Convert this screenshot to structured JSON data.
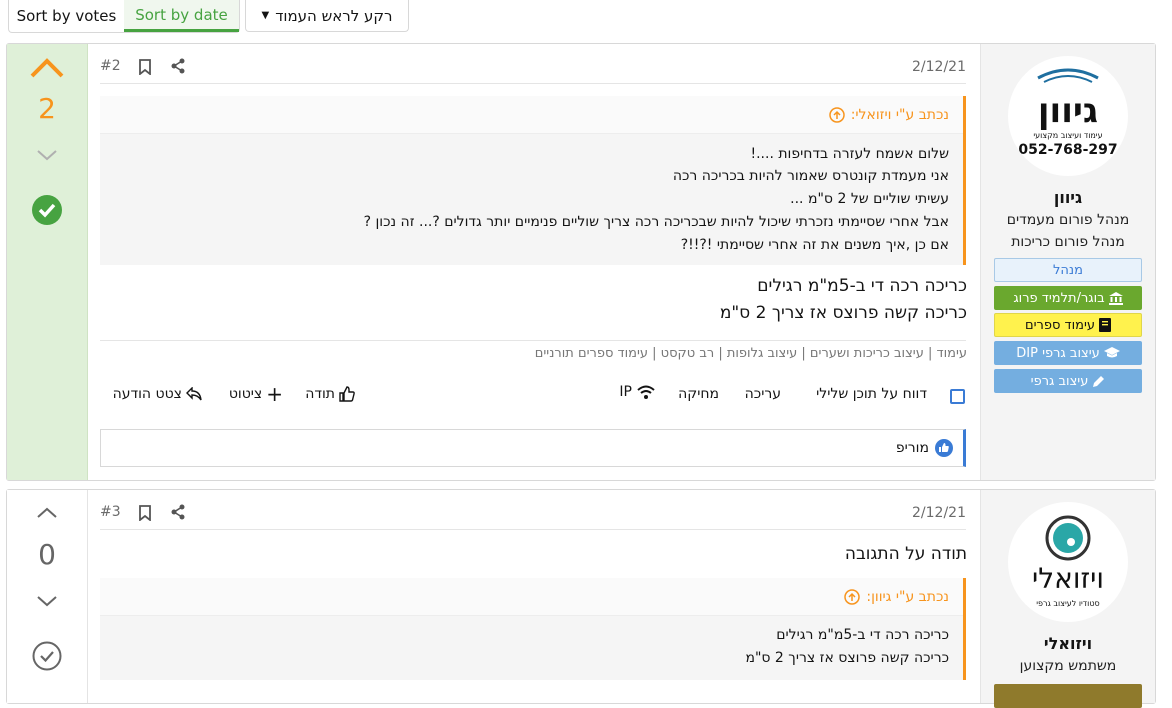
{
  "topbar": {
    "sort_votes": "Sort by votes",
    "sort_date": "Sort by date",
    "jump_top": "רקע לראש העמוד"
  },
  "colors": {
    "accent_green": "#47a341",
    "accent_orange": "#f7941d",
    "accent_blue": "#3a7bd5"
  },
  "posts": [
    {
      "index": "#2",
      "date": "2/12/21",
      "votes": "2",
      "quote": {
        "author_line": "נכתב ע\"י ויזואלי:",
        "lines": [
          "שלום אשמח לעזרה בדחיפות ....!",
          "אני מעמדת קונטרס שאמור להיות בכריכה רכה",
          "עשיתי שוליים של 2 ס\"מ ...",
          "אבל אחרי שסיימתי נזכרתי שיכול להיות שבכריכה רכה צריך שוליים פנימיים יותר גדולים ?... זה נכון ?",
          "אם כן ,איך משנים את זה אחרי שסיימתי !?!!?"
        ]
      },
      "body": [
        "כריכה רכה די ב-5מ\"מ רגילים",
        "כריכה קשה פרוצס אז צריך 2 ס\"מ"
      ],
      "tags": "עימוד | עיצוב כריכות ושערים | עיצוב גלופות | רב טקסט | עימוד ספרים תורניים",
      "actions": {
        "report": "דווח על תוכן שלילי",
        "edit": "עריכה",
        "delete": "מחיקה",
        "ip": "IP",
        "thanks": "תודה",
        "quote": "ציטוט",
        "quote_reply": "צטט הודעה"
      },
      "likes": "מוריפ",
      "user": {
        "logo_text": "גיוון",
        "logo_sub": "עימוד ועיצוב מקצועי",
        "logo_phone": "052-768-297",
        "name": "גיוון",
        "titles": [
          "מנהל פורום מעמדים",
          "מנהל פורום כריכות"
        ],
        "badges": [
          {
            "label": "מנהל",
            "icon": "none"
          },
          {
            "label": "בוגר/תלמיד פרוג",
            "icon": "bank-icon"
          },
          {
            "label": "עימוד ספרים",
            "icon": "book-icon"
          },
          {
            "label": "עיצוב גרפי DIP",
            "icon": "grad-cap-icon"
          },
          {
            "label": "עיצוב גרפי",
            "icon": "pencil-icon"
          }
        ]
      }
    },
    {
      "index": "#3",
      "date": "2/12/21",
      "votes": "0",
      "body": [
        "תודה על התגובה"
      ],
      "quote": {
        "author_line": "נכתב ע\"י גיוון:",
        "lines": [
          "כריכה רכה די ב-5מ\"מ רגילים",
          "כריכה קשה פרוצס אז צריך 2 ס\"מ"
        ]
      },
      "user": {
        "logo_text": "ויזואלי",
        "logo_sub": "סטודיו לעיצוב גרפי",
        "name": "ויזואלי",
        "titles": [
          "משתמש מקצוען"
        ]
      }
    }
  ]
}
